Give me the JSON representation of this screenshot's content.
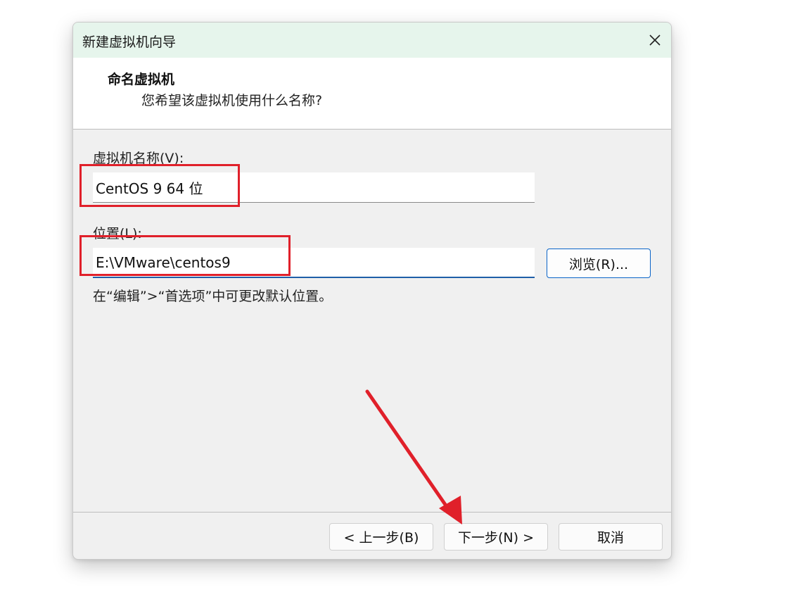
{
  "dialog": {
    "title": "新建虚拟机向导",
    "close_icon": "close-icon"
  },
  "header": {
    "title": "命名虚拟机",
    "subtitle": "您希望该虚拟机使用什么名称?"
  },
  "form": {
    "name_label": "虚拟机名称(V):",
    "name_value": "CentOS 9 64 位",
    "location_label": "位置(L):",
    "location_value": "E:\\VMware\\centos9",
    "browse_label": "浏览(R)...",
    "hint": "在“编辑”>“首选项”中可更改默认位置。"
  },
  "footer": {
    "back_label": "< 上一步(B)",
    "next_label": "下一步(N) >",
    "cancel_label": "取消"
  },
  "colors": {
    "title_bar": "#e6f5ec",
    "dialog_bg": "#f0f0f0",
    "annotation": "#e0202a",
    "focus_accent": "#1f5fa8"
  }
}
